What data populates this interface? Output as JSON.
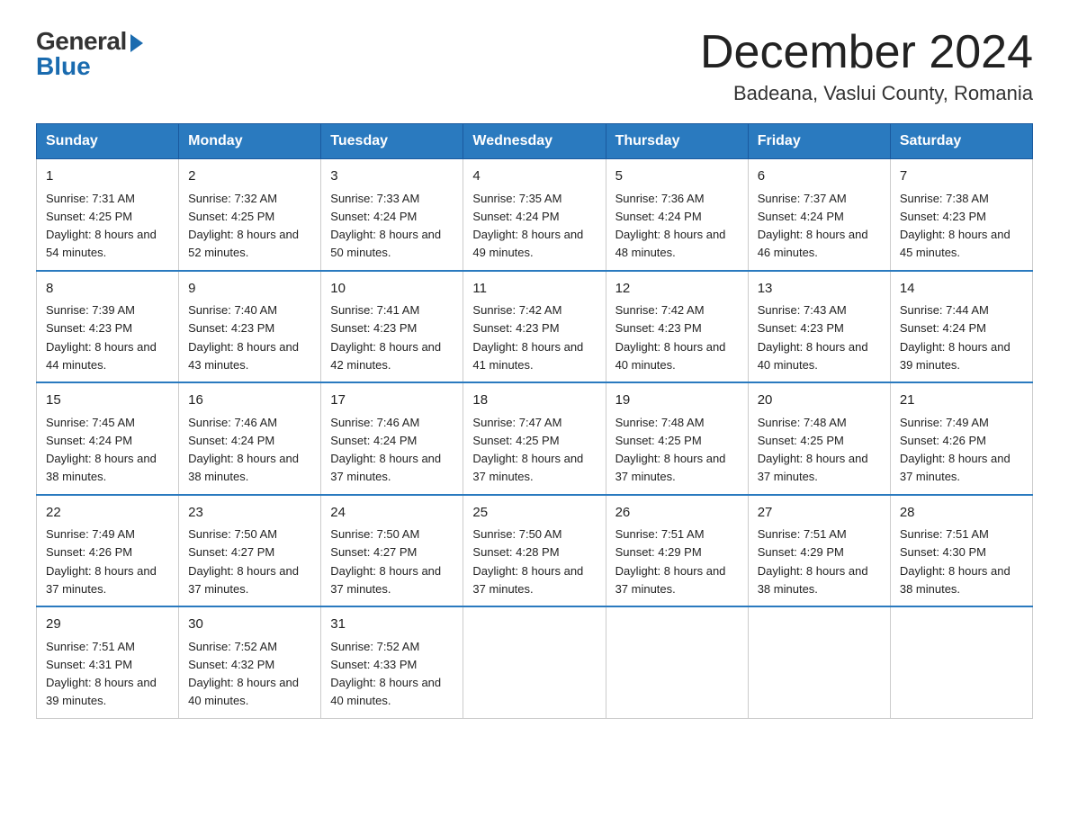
{
  "logo": {
    "general": "General",
    "blue": "Blue"
  },
  "title": "December 2024",
  "location": "Badeana, Vaslui County, Romania",
  "days_of_week": [
    "Sunday",
    "Monday",
    "Tuesday",
    "Wednesday",
    "Thursday",
    "Friday",
    "Saturday"
  ],
  "weeks": [
    [
      {
        "day": "1",
        "sunrise": "7:31 AM",
        "sunset": "4:25 PM",
        "daylight": "8 hours and 54 minutes."
      },
      {
        "day": "2",
        "sunrise": "7:32 AM",
        "sunset": "4:25 PM",
        "daylight": "8 hours and 52 minutes."
      },
      {
        "day": "3",
        "sunrise": "7:33 AM",
        "sunset": "4:24 PM",
        "daylight": "8 hours and 50 minutes."
      },
      {
        "day": "4",
        "sunrise": "7:35 AM",
        "sunset": "4:24 PM",
        "daylight": "8 hours and 49 minutes."
      },
      {
        "day": "5",
        "sunrise": "7:36 AM",
        "sunset": "4:24 PM",
        "daylight": "8 hours and 48 minutes."
      },
      {
        "day": "6",
        "sunrise": "7:37 AM",
        "sunset": "4:24 PM",
        "daylight": "8 hours and 46 minutes."
      },
      {
        "day": "7",
        "sunrise": "7:38 AM",
        "sunset": "4:23 PM",
        "daylight": "8 hours and 45 minutes."
      }
    ],
    [
      {
        "day": "8",
        "sunrise": "7:39 AM",
        "sunset": "4:23 PM",
        "daylight": "8 hours and 44 minutes."
      },
      {
        "day": "9",
        "sunrise": "7:40 AM",
        "sunset": "4:23 PM",
        "daylight": "8 hours and 43 minutes."
      },
      {
        "day": "10",
        "sunrise": "7:41 AM",
        "sunset": "4:23 PM",
        "daylight": "8 hours and 42 minutes."
      },
      {
        "day": "11",
        "sunrise": "7:42 AM",
        "sunset": "4:23 PM",
        "daylight": "8 hours and 41 minutes."
      },
      {
        "day": "12",
        "sunrise": "7:42 AM",
        "sunset": "4:23 PM",
        "daylight": "8 hours and 40 minutes."
      },
      {
        "day": "13",
        "sunrise": "7:43 AM",
        "sunset": "4:23 PM",
        "daylight": "8 hours and 40 minutes."
      },
      {
        "day": "14",
        "sunrise": "7:44 AM",
        "sunset": "4:24 PM",
        "daylight": "8 hours and 39 minutes."
      }
    ],
    [
      {
        "day": "15",
        "sunrise": "7:45 AM",
        "sunset": "4:24 PM",
        "daylight": "8 hours and 38 minutes."
      },
      {
        "day": "16",
        "sunrise": "7:46 AM",
        "sunset": "4:24 PM",
        "daylight": "8 hours and 38 minutes."
      },
      {
        "day": "17",
        "sunrise": "7:46 AM",
        "sunset": "4:24 PM",
        "daylight": "8 hours and 37 minutes."
      },
      {
        "day": "18",
        "sunrise": "7:47 AM",
        "sunset": "4:25 PM",
        "daylight": "8 hours and 37 minutes."
      },
      {
        "day": "19",
        "sunrise": "7:48 AM",
        "sunset": "4:25 PM",
        "daylight": "8 hours and 37 minutes."
      },
      {
        "day": "20",
        "sunrise": "7:48 AM",
        "sunset": "4:25 PM",
        "daylight": "8 hours and 37 minutes."
      },
      {
        "day": "21",
        "sunrise": "7:49 AM",
        "sunset": "4:26 PM",
        "daylight": "8 hours and 37 minutes."
      }
    ],
    [
      {
        "day": "22",
        "sunrise": "7:49 AM",
        "sunset": "4:26 PM",
        "daylight": "8 hours and 37 minutes."
      },
      {
        "day": "23",
        "sunrise": "7:50 AM",
        "sunset": "4:27 PM",
        "daylight": "8 hours and 37 minutes."
      },
      {
        "day": "24",
        "sunrise": "7:50 AM",
        "sunset": "4:27 PM",
        "daylight": "8 hours and 37 minutes."
      },
      {
        "day": "25",
        "sunrise": "7:50 AM",
        "sunset": "4:28 PM",
        "daylight": "8 hours and 37 minutes."
      },
      {
        "day": "26",
        "sunrise": "7:51 AM",
        "sunset": "4:29 PM",
        "daylight": "8 hours and 37 minutes."
      },
      {
        "day": "27",
        "sunrise": "7:51 AM",
        "sunset": "4:29 PM",
        "daylight": "8 hours and 38 minutes."
      },
      {
        "day": "28",
        "sunrise": "7:51 AM",
        "sunset": "4:30 PM",
        "daylight": "8 hours and 38 minutes."
      }
    ],
    [
      {
        "day": "29",
        "sunrise": "7:51 AM",
        "sunset": "4:31 PM",
        "daylight": "8 hours and 39 minutes."
      },
      {
        "day": "30",
        "sunrise": "7:52 AM",
        "sunset": "4:32 PM",
        "daylight": "8 hours and 40 minutes."
      },
      {
        "day": "31",
        "sunrise": "7:52 AM",
        "sunset": "4:33 PM",
        "daylight": "8 hours and 40 minutes."
      },
      null,
      null,
      null,
      null
    ]
  ]
}
